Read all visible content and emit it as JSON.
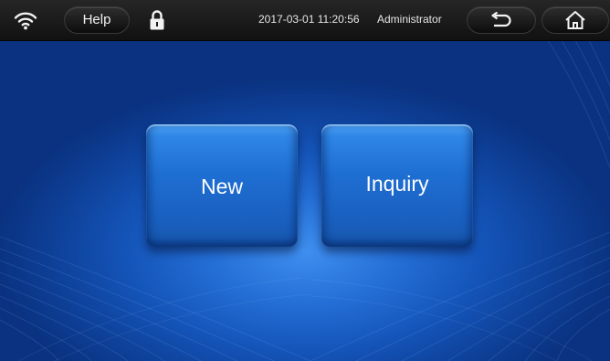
{
  "topbar": {
    "help_label": "Help",
    "datetime": "2017-03-01  11:20:56",
    "user": "Administrator",
    "icons": {
      "wifi": "wifi-icon",
      "lock": "lock-icon",
      "back": "back-arrow-icon",
      "home": "home-icon"
    }
  },
  "main": {
    "new_label": "New",
    "inquiry_label": "Inquiry"
  },
  "colors": {
    "topbar": "#1a1a1a",
    "background": "#1454b8",
    "button": "#1f6fd3",
    "text": "#ffffff"
  }
}
